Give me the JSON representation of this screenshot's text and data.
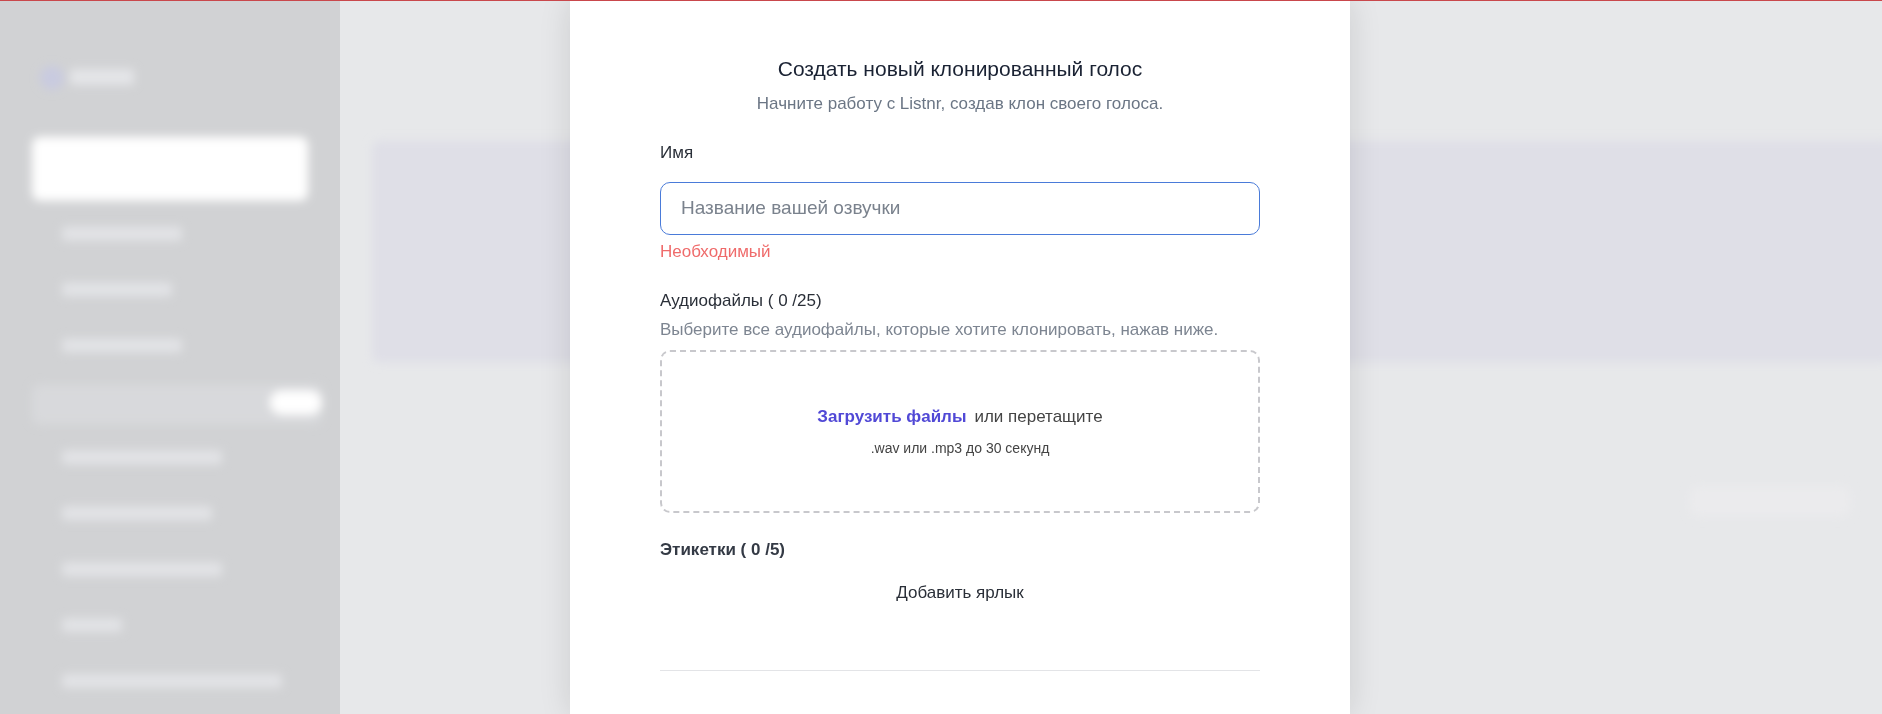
{
  "dialog": {
    "title": "Создать новый клонированный голос",
    "subtitle": "Начните работу с Listnr, создав клон своего голоса."
  },
  "name_field": {
    "label": "Имя",
    "placeholder": "Название вашей озвучки",
    "focused": true,
    "error": "Необходимый"
  },
  "audio": {
    "label": "Аудиофайлы ( 0 /25)",
    "hint": "Выберите все аудиофайлы, которые хотите клонировать, нажав ниже.",
    "upload_link": "Загрузить файлы",
    "drop_text": "или перетащите",
    "formats": ".wav или .mp3 до 30 секунд"
  },
  "tags": {
    "label": "Этикетки ( 0 /5)",
    "add_button": "Добавить ярлык"
  }
}
